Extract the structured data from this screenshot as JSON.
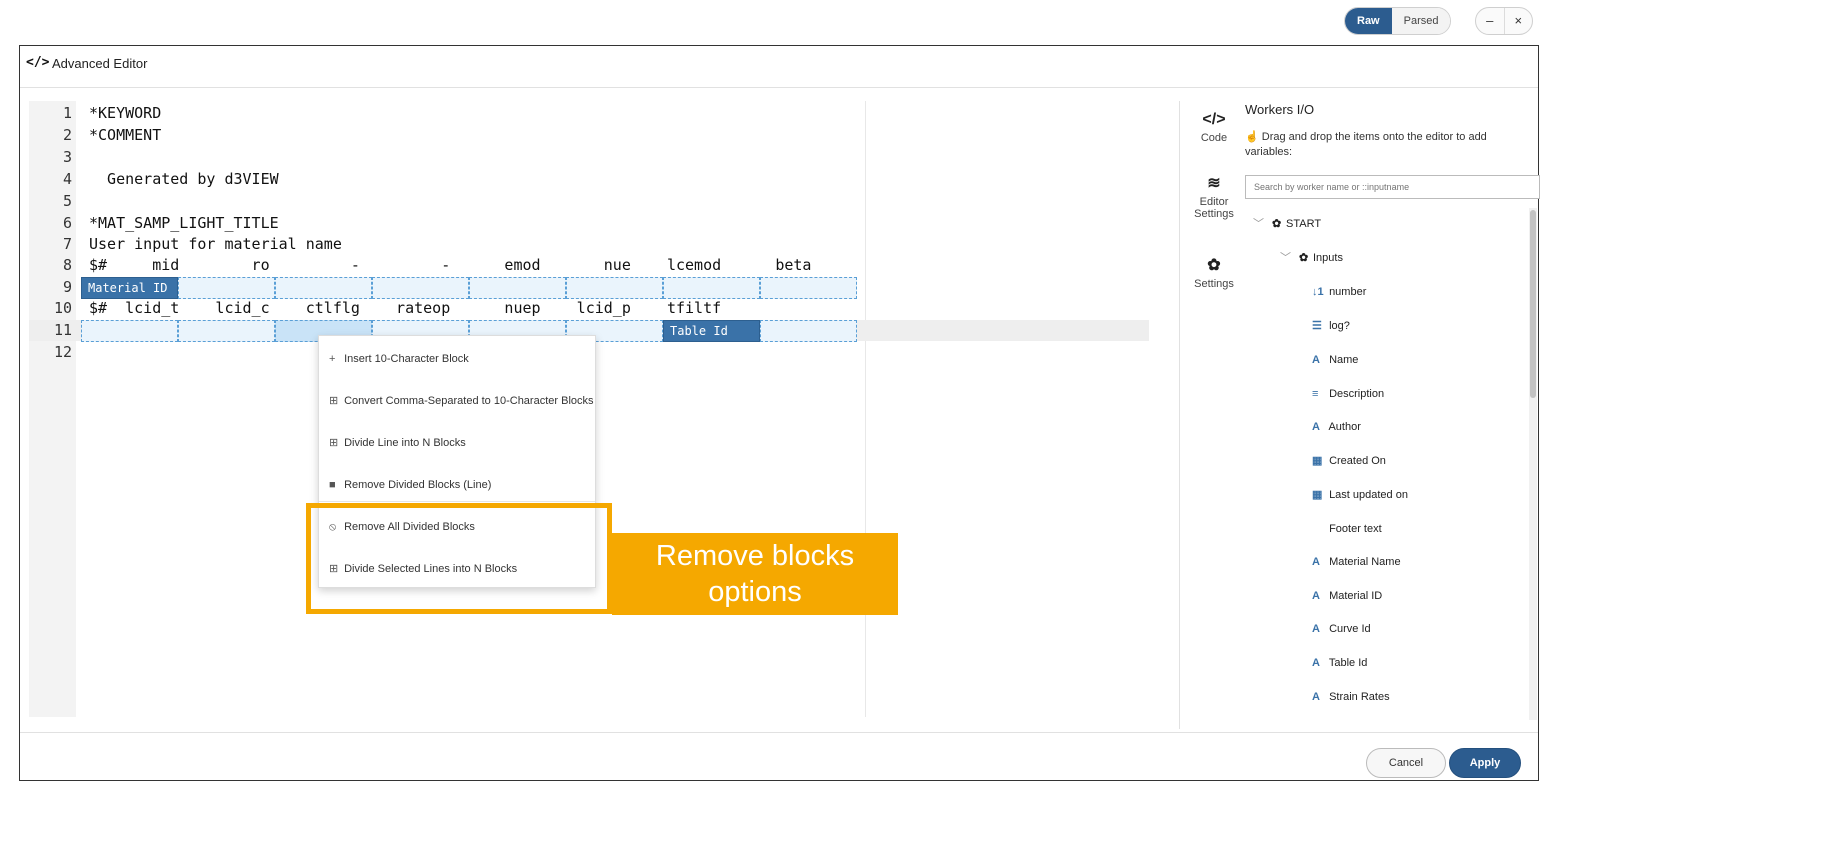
{
  "window": {
    "icon": "</>",
    "title": "Advanced Editor",
    "toggle": [
      "Raw",
      "Parsed"
    ],
    "minimize": "–",
    "close": "×"
  },
  "editor": {
    "lines": [
      {
        "num": "1",
        "text": "*KEYWORD"
      },
      {
        "num": "2",
        "text": "*COMMENT"
      },
      {
        "num": "3",
        "text": ""
      },
      {
        "num": "4",
        "text": "  Generated by d3VIEW"
      },
      {
        "num": "5",
        "text": ""
      },
      {
        "num": "6",
        "text": "*MAT_SAMP_LIGHT_TITLE"
      },
      {
        "num": "7",
        "text": "User input for material name"
      },
      {
        "num": "8",
        "text": "$#     mid        ro         -         -      emod       nue    lcemod      beta"
      },
      {
        "num": "9",
        "text": ""
      },
      {
        "num": "10",
        "text": "$#  lcid_t    lcid_c    ctlflg    rateop      nuep    lcid_p    tfiltf"
      },
      {
        "num": "11",
        "text": ""
      },
      {
        "num": "12",
        "text": ""
      }
    ],
    "block_tags": {
      "row9": "Material ID",
      "row11": "Table Id"
    }
  },
  "context_menu": {
    "items": [
      {
        "icon": "+",
        "label": "Insert 10-Character Block"
      },
      {
        "icon": "⊞",
        "label": "Convert Comma-Separated to 10-Character Blocks"
      },
      {
        "icon": "⊞",
        "label": "Divide Line into N Blocks"
      },
      {
        "icon": "■",
        "label": "Remove Divided Blocks (Line)"
      },
      {
        "icon": "⦸",
        "label": "Remove All Divided Blocks"
      },
      {
        "icon": "⊞",
        "label": "Divide Selected Lines into N Blocks"
      }
    ]
  },
  "callout": {
    "line1": "Remove blocks",
    "line2": "options",
    "color": "#f5a800"
  },
  "side_nav": [
    {
      "icon": "</>",
      "label": "Code"
    },
    {
      "icon": "≋",
      "label_1": "Editor",
      "label_2": "Settings"
    },
    {
      "icon": "✿",
      "label": "Settings"
    }
  ],
  "workers_io": {
    "title": "Workers I/O",
    "hint": "Drag and drop the items onto the editor to add variables:",
    "search_placeholder": "Search by worker name or ::inputname",
    "tree": {
      "root": "START",
      "group": "Inputs",
      "items": [
        {
          "icon": "↓1",
          "label": "number"
        },
        {
          "icon": "☰",
          "label": "log?"
        },
        {
          "icon": "A",
          "label": "Name"
        },
        {
          "icon": "≡",
          "label": "Description"
        },
        {
          "icon": "A",
          "label": "Author"
        },
        {
          "icon": "▦",
          "label": "Created On"
        },
        {
          "icon": "▦",
          "label": "Last updated on"
        },
        {
          "icon": "",
          "label": "Footer text"
        },
        {
          "icon": "A",
          "label": "Material Name"
        },
        {
          "icon": "A",
          "label": "Material ID"
        },
        {
          "icon": "A",
          "label": "Curve Id"
        },
        {
          "icon": "A",
          "label": "Table Id"
        },
        {
          "icon": "A",
          "label": "Strain Rates"
        }
      ]
    }
  },
  "footer": {
    "cancel": "Cancel",
    "apply": "Apply"
  },
  "colors": {
    "accent": "#2c5c8f",
    "highlight": "#f5a800",
    "block_border": "#5a9fd6"
  }
}
